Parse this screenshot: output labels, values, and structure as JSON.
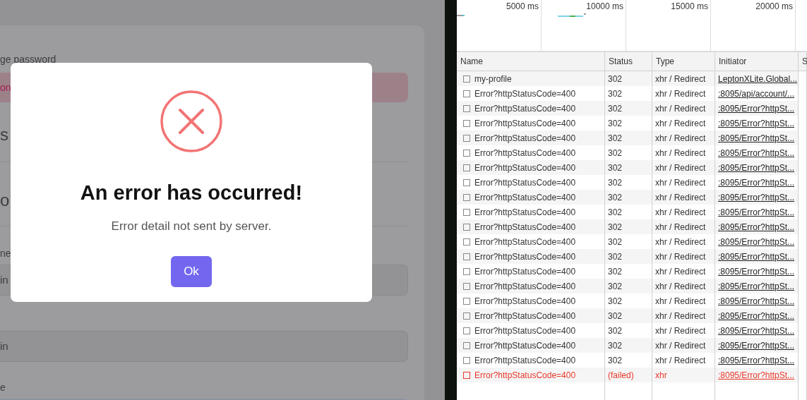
{
  "app": {
    "password_label": "ge password",
    "alert_text": "on",
    "heading_1": "s",
    "heading_2": "o",
    "label_1": "ne",
    "field_1": "in",
    "field_2": "in",
    "label_2": "e"
  },
  "dialog": {
    "title": "An error has occurred!",
    "message": "Error detail not sent by server.",
    "button": "Ok"
  },
  "devtools": {
    "timeline_ticks": [
      "5000 ms",
      "10000 ms",
      "15000 ms",
      "20000 ms"
    ],
    "columns": [
      "Name",
      "Status",
      "Type",
      "Initiator",
      "S"
    ],
    "rows": [
      {
        "name": "my-profile",
        "status": "302",
        "type": "xhr / Redirect",
        "initiator": "LeptonXLite.Global...",
        "failed": false
      },
      {
        "name": "Error?httpStatusCode=400",
        "status": "302",
        "type": "xhr / Redirect",
        "initiator": ":8095/api/account/...",
        "failed": false
      },
      {
        "name": "Error?httpStatusCode=400",
        "status": "302",
        "type": "xhr / Redirect",
        "initiator": ":8095/Error?httpSt...",
        "failed": false
      },
      {
        "name": "Error?httpStatusCode=400",
        "status": "302",
        "type": "xhr / Redirect",
        "initiator": ":8095/Error?httpSt...",
        "failed": false
      },
      {
        "name": "Error?httpStatusCode=400",
        "status": "302",
        "type": "xhr / Redirect",
        "initiator": ":8095/Error?httpSt...",
        "failed": false
      },
      {
        "name": "Error?httpStatusCode=400",
        "status": "302",
        "type": "xhr / Redirect",
        "initiator": ":8095/Error?httpSt...",
        "failed": false
      },
      {
        "name": "Error?httpStatusCode=400",
        "status": "302",
        "type": "xhr / Redirect",
        "initiator": ":8095/Error?httpSt...",
        "failed": false
      },
      {
        "name": "Error?httpStatusCode=400",
        "status": "302",
        "type": "xhr / Redirect",
        "initiator": ":8095/Error?httpSt...",
        "failed": false
      },
      {
        "name": "Error?httpStatusCode=400",
        "status": "302",
        "type": "xhr / Redirect",
        "initiator": ":8095/Error?httpSt...",
        "failed": false
      },
      {
        "name": "Error?httpStatusCode=400",
        "status": "302",
        "type": "xhr / Redirect",
        "initiator": ":8095/Error?httpSt...",
        "failed": false
      },
      {
        "name": "Error?httpStatusCode=400",
        "status": "302",
        "type": "xhr / Redirect",
        "initiator": ":8095/Error?httpSt...",
        "failed": false
      },
      {
        "name": "Error?httpStatusCode=400",
        "status": "302",
        "type": "xhr / Redirect",
        "initiator": ":8095/Error?httpSt...",
        "failed": false
      },
      {
        "name": "Error?httpStatusCode=400",
        "status": "302",
        "type": "xhr / Redirect",
        "initiator": ":8095/Error?httpSt...",
        "failed": false
      },
      {
        "name": "Error?httpStatusCode=400",
        "status": "302",
        "type": "xhr / Redirect",
        "initiator": ":8095/Error?httpSt...",
        "failed": false
      },
      {
        "name": "Error?httpStatusCode=400",
        "status": "302",
        "type": "xhr / Redirect",
        "initiator": ":8095/Error?httpSt...",
        "failed": false
      },
      {
        "name": "Error?httpStatusCode=400",
        "status": "302",
        "type": "xhr / Redirect",
        "initiator": ":8095/Error?httpSt...",
        "failed": false
      },
      {
        "name": "Error?httpStatusCode=400",
        "status": "302",
        "type": "xhr / Redirect",
        "initiator": ":8095/Error?httpSt...",
        "failed": false
      },
      {
        "name": "Error?httpStatusCode=400",
        "status": "302",
        "type": "xhr / Redirect",
        "initiator": ":8095/Error?httpSt...",
        "failed": false
      },
      {
        "name": "Error?httpStatusCode=400",
        "status": "302",
        "type": "xhr / Redirect",
        "initiator": ":8095/Error?httpSt...",
        "failed": false
      },
      {
        "name": "Error?httpStatusCode=400",
        "status": "302",
        "type": "xhr / Redirect",
        "initiator": ":8095/Error?httpSt...",
        "failed": false
      },
      {
        "name": "Error?httpStatusCode=400",
        "status": "(failed)",
        "type": "xhr",
        "initiator": ":8095/Error?httpSt...",
        "failed": true
      }
    ]
  }
}
